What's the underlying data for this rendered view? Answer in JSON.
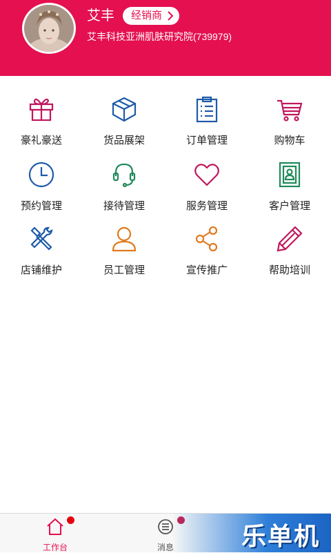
{
  "profile": {
    "name": "艾丰",
    "role": "经销商",
    "company": "艾丰科技亚洲肌肤研究院(739979)"
  },
  "menu": [
    {
      "label": "豪礼豪送",
      "icon": "gift-icon",
      "color": "#c0175d"
    },
    {
      "label": "货品展架",
      "icon": "box-icon",
      "color": "#1d5aa8"
    },
    {
      "label": "订单管理",
      "icon": "clipboard-icon",
      "color": "#1d5aa8"
    },
    {
      "label": "购物车",
      "icon": "cart-icon",
      "color": "#c0175d"
    },
    {
      "label": "预约管理",
      "icon": "clock-icon",
      "color": "#1d5aa8"
    },
    {
      "label": "接待管理",
      "icon": "headset-icon",
      "color": "#1e8a5a"
    },
    {
      "label": "服务管理",
      "icon": "heart-icon",
      "color": "#c0175d"
    },
    {
      "label": "客户管理",
      "icon": "contact-book-icon",
      "color": "#1e8a5a"
    },
    {
      "label": "店铺维护",
      "icon": "tools-icon",
      "color": "#1d5aa8"
    },
    {
      "label": "员工管理",
      "icon": "user-icon",
      "color": "#e07a1e"
    },
    {
      "label": "宣传推广",
      "icon": "share-icon",
      "color": "#e07a1e"
    },
    {
      "label": "帮助培训",
      "icon": "pencil-icon",
      "color": "#c0175d"
    }
  ],
  "tabs": [
    {
      "label": "工作台",
      "icon": "home-icon",
      "active": true
    },
    {
      "label": "消息",
      "icon": "message-icon",
      "active": false
    }
  ],
  "watermark": "乐单机",
  "colors": {
    "brand": "#e5104f",
    "badge": "#e60012"
  }
}
